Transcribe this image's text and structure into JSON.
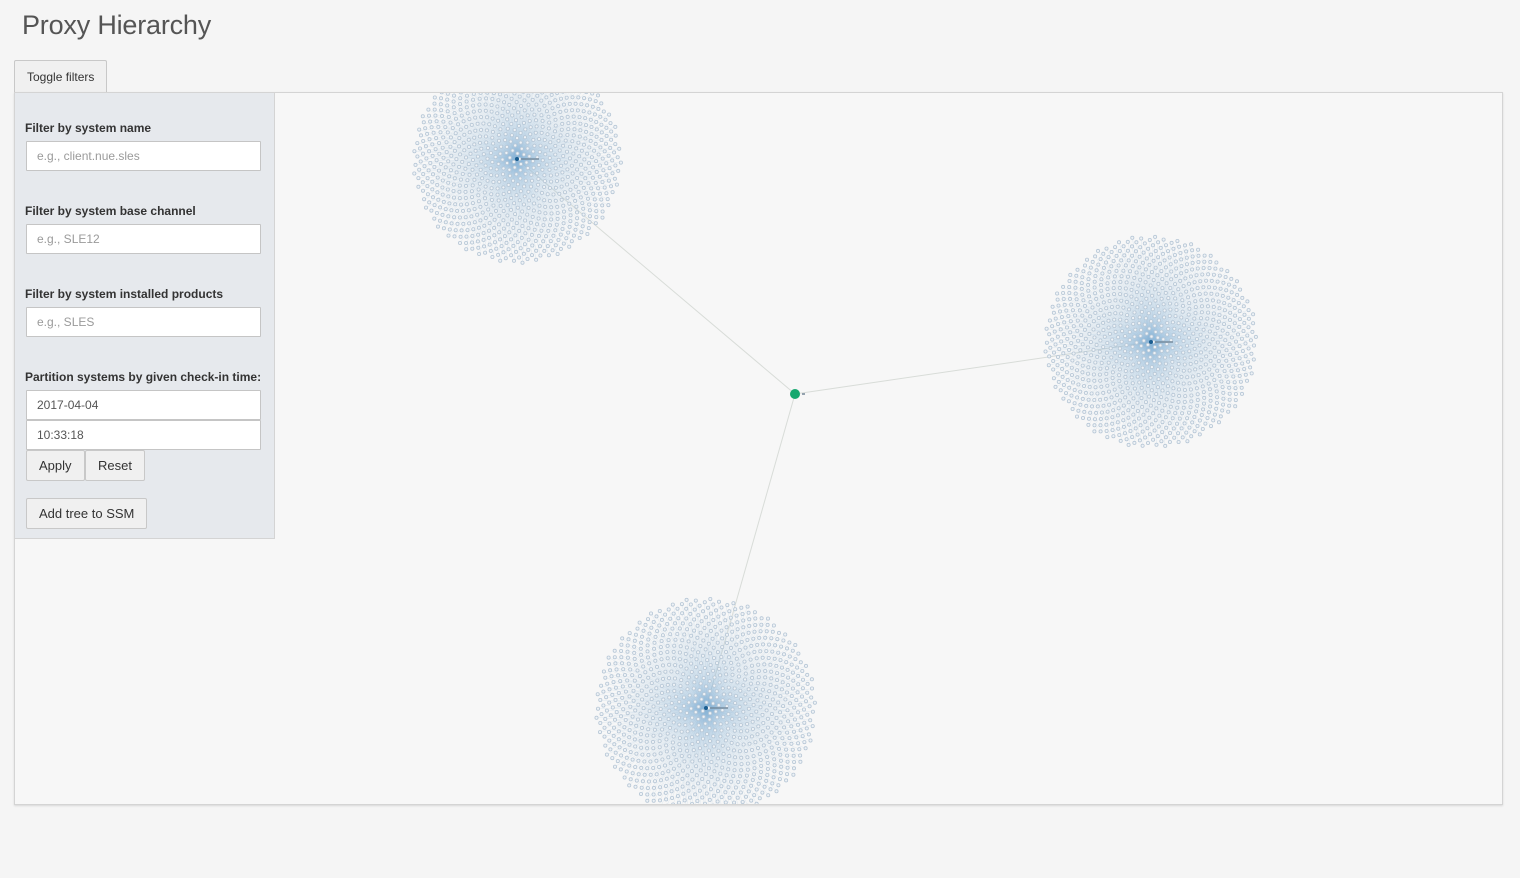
{
  "page": {
    "title": "Proxy Hierarchy"
  },
  "toolbar": {
    "toggle_filters_label": "Toggle filters"
  },
  "filters": {
    "system_name": {
      "label": "Filter by system name",
      "placeholder": "e.g., client.nue.sles"
    },
    "base_channel": {
      "label": "Filter by system base channel",
      "placeholder": "e.g., SLE12"
    },
    "installed_products": {
      "label": "Filter by system installed products",
      "placeholder": "e.g., SLES"
    },
    "checkin": {
      "label": "Partition systems by given check-in time:",
      "date_value": "2017-04-04",
      "time_value": "10:33:18",
      "apply_label": "Apply",
      "reset_label": "Reset"
    },
    "add_to_ssm_label": "Add tree to SSM"
  },
  "graph": {
    "colors": {
      "root": "#16a86f",
      "proxy": "#1b5e91",
      "leaf": "#b7c7d6",
      "edge": "#8fb8d8",
      "link": "#d8dcd8"
    }
  }
}
